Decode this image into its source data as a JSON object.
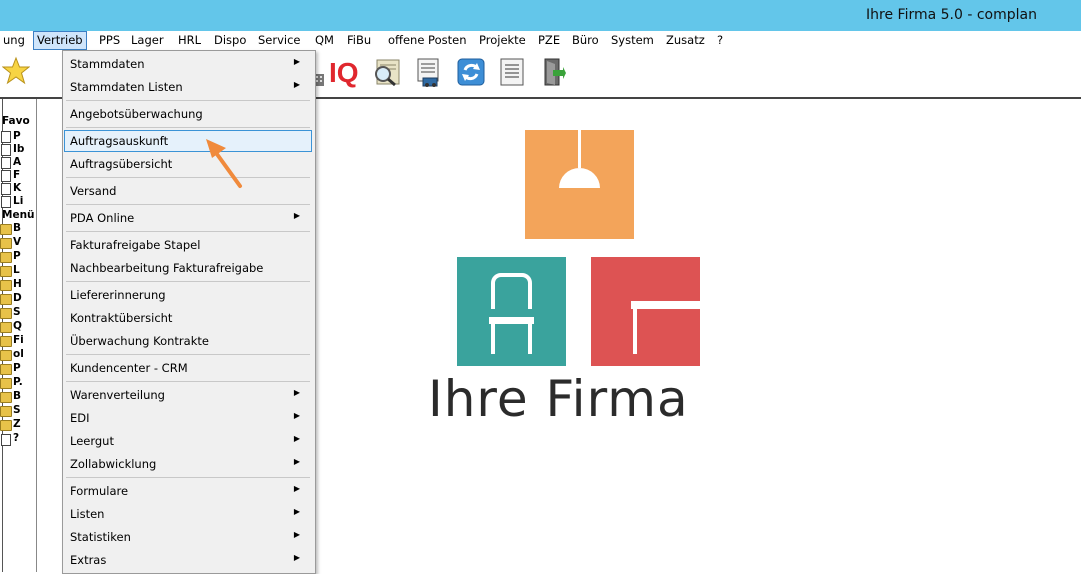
{
  "window": {
    "title": "Ihre Firma 5.0  - complan"
  },
  "menubar": {
    "items": [
      {
        "label": "ung"
      },
      {
        "label": "Vertrieb",
        "active": true
      },
      {
        "label": "PPS"
      },
      {
        "label": "Lager"
      },
      {
        "label": "HRL"
      },
      {
        "label": "Dispo"
      },
      {
        "label": "Service"
      },
      {
        "label": "QM"
      },
      {
        "label": "FiBu"
      },
      {
        "label": "offene Posten"
      },
      {
        "label": "Projekte"
      },
      {
        "label": "PZE"
      },
      {
        "label": "Büro"
      },
      {
        "label": "System"
      },
      {
        "label": "Zusatz"
      },
      {
        "label": "?"
      }
    ]
  },
  "toolbar": {
    "icons": [
      "star-icon",
      "calculator-icon",
      "iq-icon",
      "search-document-icon",
      "printer-icon",
      "refresh-icon",
      "list-document-icon",
      "exit-door-icon"
    ],
    "iq_label": "IQ"
  },
  "left_panel": {
    "favorites_header": "Favo",
    "menu_header": "Menü",
    "favorites": [
      "P",
      "Ib",
      "A",
      "F",
      "K",
      "Li"
    ],
    "menu_items": [
      "B",
      "V",
      "P",
      "L",
      "H",
      "D",
      "S",
      "Q",
      "Fi",
      "ol",
      "P",
      "P.",
      "B",
      "S",
      "Z",
      "?"
    ]
  },
  "dropdown": {
    "items": [
      {
        "label": "Stammdaten",
        "submenu": true
      },
      {
        "label": "Stammdaten Listen",
        "submenu": true
      },
      {
        "label": "Angebotsüberwachung",
        "submenu": false
      },
      {
        "label": "Auftragsauskunft",
        "submenu": false,
        "highlighted": true
      },
      {
        "label": "Auftragsübersicht",
        "submenu": false
      },
      {
        "label": "Versand",
        "submenu": false
      },
      {
        "label": "PDA Online",
        "submenu": true
      },
      {
        "label": "Fakturafreigabe Stapel",
        "submenu": false
      },
      {
        "label": "Nachbearbeitung Fakturafreigabe",
        "submenu": false
      },
      {
        "label": "Liefererinnerung",
        "submenu": false
      },
      {
        "label": "Kontraktübersicht",
        "submenu": false
      },
      {
        "label": "Überwachung Kontrakte",
        "submenu": false
      },
      {
        "label": "Kundencenter - CRM",
        "submenu": false
      },
      {
        "label": "Warenverteilung",
        "submenu": true
      },
      {
        "label": "EDI",
        "submenu": true
      },
      {
        "label": "Leergut",
        "submenu": true
      },
      {
        "label": "Zollabwicklung",
        "submenu": true
      },
      {
        "label": "Formulare",
        "submenu": true
      },
      {
        "label": "Listen",
        "submenu": true
      },
      {
        "label": "Statistiken",
        "submenu": true
      },
      {
        "label": "Extras",
        "submenu": true
      }
    ],
    "arrow_glyph": "▶"
  },
  "logo": {
    "brand_text": "Ihre Firma",
    "colors": {
      "lamp_box": "#f3a45a",
      "chair_box": "#3aa39d",
      "table_box": "#dd5353"
    }
  },
  "colors": {
    "titlebar": "#63c6ea",
    "highlight_border": "#3b93d6",
    "highlight_fill": "#e5f1fb",
    "pointer": "#f08a3c"
  }
}
